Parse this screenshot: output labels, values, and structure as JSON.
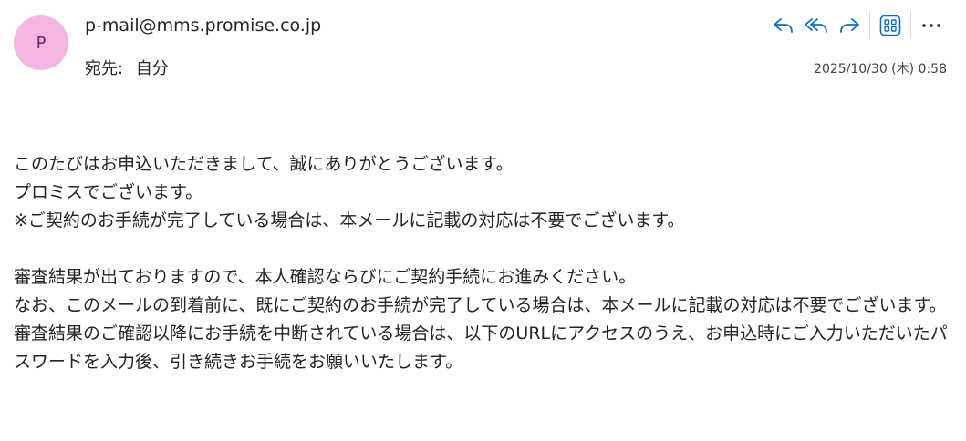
{
  "header": {
    "avatar_initial": "P",
    "sender": "p-mail@mms.promise.co.jp",
    "to_label": "宛先:",
    "to_value": "自分",
    "timestamp": "2025/10/30 (木) 0:58"
  },
  "toolbar": {
    "icons": [
      "reply-icon",
      "reply-all-icon",
      "forward-icon",
      "apps-icon",
      "more-icon"
    ],
    "accent_color": "#0f6cbd"
  },
  "body": {
    "para1": [
      "このたびはお申込いただきまして、誠にありがとうございます。",
      "プロミスでございます。",
      "※ご契約のお手続が完了している場合は、本メールに記載の対応は不要でございます。"
    ],
    "para2": [
      "審査結果が出ておりますので、本人確認ならびにご契約手続にお進みください。",
      "なお、このメールの到着前に、既にご契約のお手続が完了している場合は、本メールに記載の対応は不要でございます。",
      "審査結果のご確認以降にお手続を中断されている場合は、以下のURLにアクセスのうえ、お申込時にご入力いただいたパスワードを入力後、引き続きお手続をお願いいたします。"
    ]
  }
}
